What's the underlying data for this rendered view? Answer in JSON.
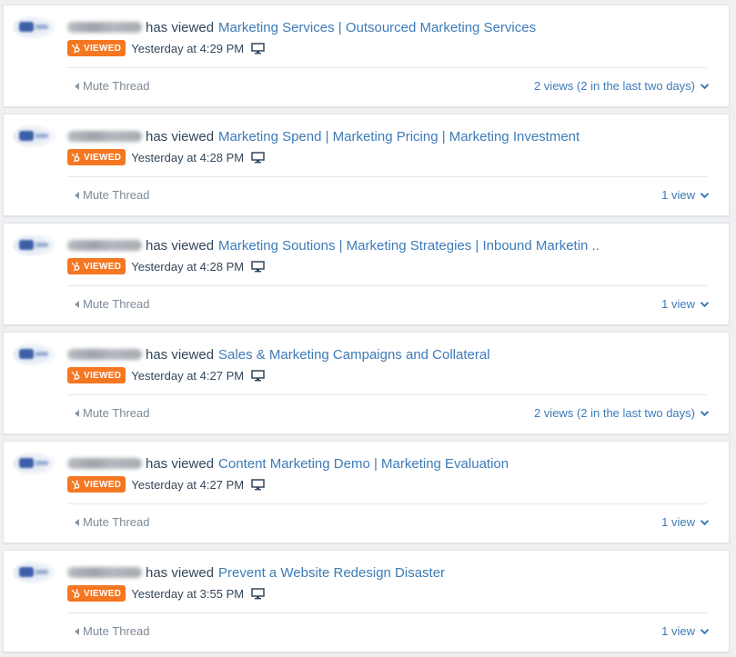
{
  "feed": {
    "items": [
      {
        "verb": "has viewed",
        "page_title": "Marketing Services | Outsourced Marketing Services",
        "badge": "VIEWED",
        "time": "Yesterday at 4:29 PM",
        "mute_label": "Mute Thread",
        "views_label": "2 views (2 in the last two days)"
      },
      {
        "verb": "has viewed",
        "page_title": "Marketing Spend | Marketing Pricing | Marketing Investment",
        "badge": "VIEWED",
        "time": "Yesterday at 4:28 PM",
        "mute_label": "Mute Thread",
        "views_label": "1 view"
      },
      {
        "verb": "has viewed",
        "page_title": "Marketing Soutions | Marketing Strategies | Inbound Marketin ..",
        "badge": "VIEWED",
        "time": "Yesterday at 4:28 PM",
        "mute_label": "Mute Thread",
        "views_label": "1 view"
      },
      {
        "verb": "has viewed",
        "page_title": "Sales & Marketing Campaigns and Collateral",
        "badge": "VIEWED",
        "time": "Yesterday at 4:27 PM",
        "mute_label": "Mute Thread",
        "views_label": "2 views (2 in the last two days)"
      },
      {
        "verb": "has viewed",
        "page_title": "Content Marketing Demo | Marketing Evaluation",
        "badge": "VIEWED",
        "time": "Yesterday at 4:27 PM",
        "mute_label": "Mute Thread",
        "views_label": "1 view"
      },
      {
        "verb": "has viewed",
        "page_title": "Prevent a Website Redesign Disaster",
        "badge": "VIEWED",
        "time": "Yesterday at 3:55 PM",
        "mute_label": "Mute Thread",
        "views_label": "1 view"
      }
    ]
  },
  "icons": {
    "badge_icon": "hubspot-sprocket-icon",
    "device_icon": "desktop-monitor-icon",
    "mute_icon": "caret-left-icon",
    "views_icon": "chevron-down-icon"
  },
  "colors": {
    "link": "#3d7bb8",
    "badge": "#f57722",
    "text": "#33475b",
    "muted": "#7c8a97"
  }
}
